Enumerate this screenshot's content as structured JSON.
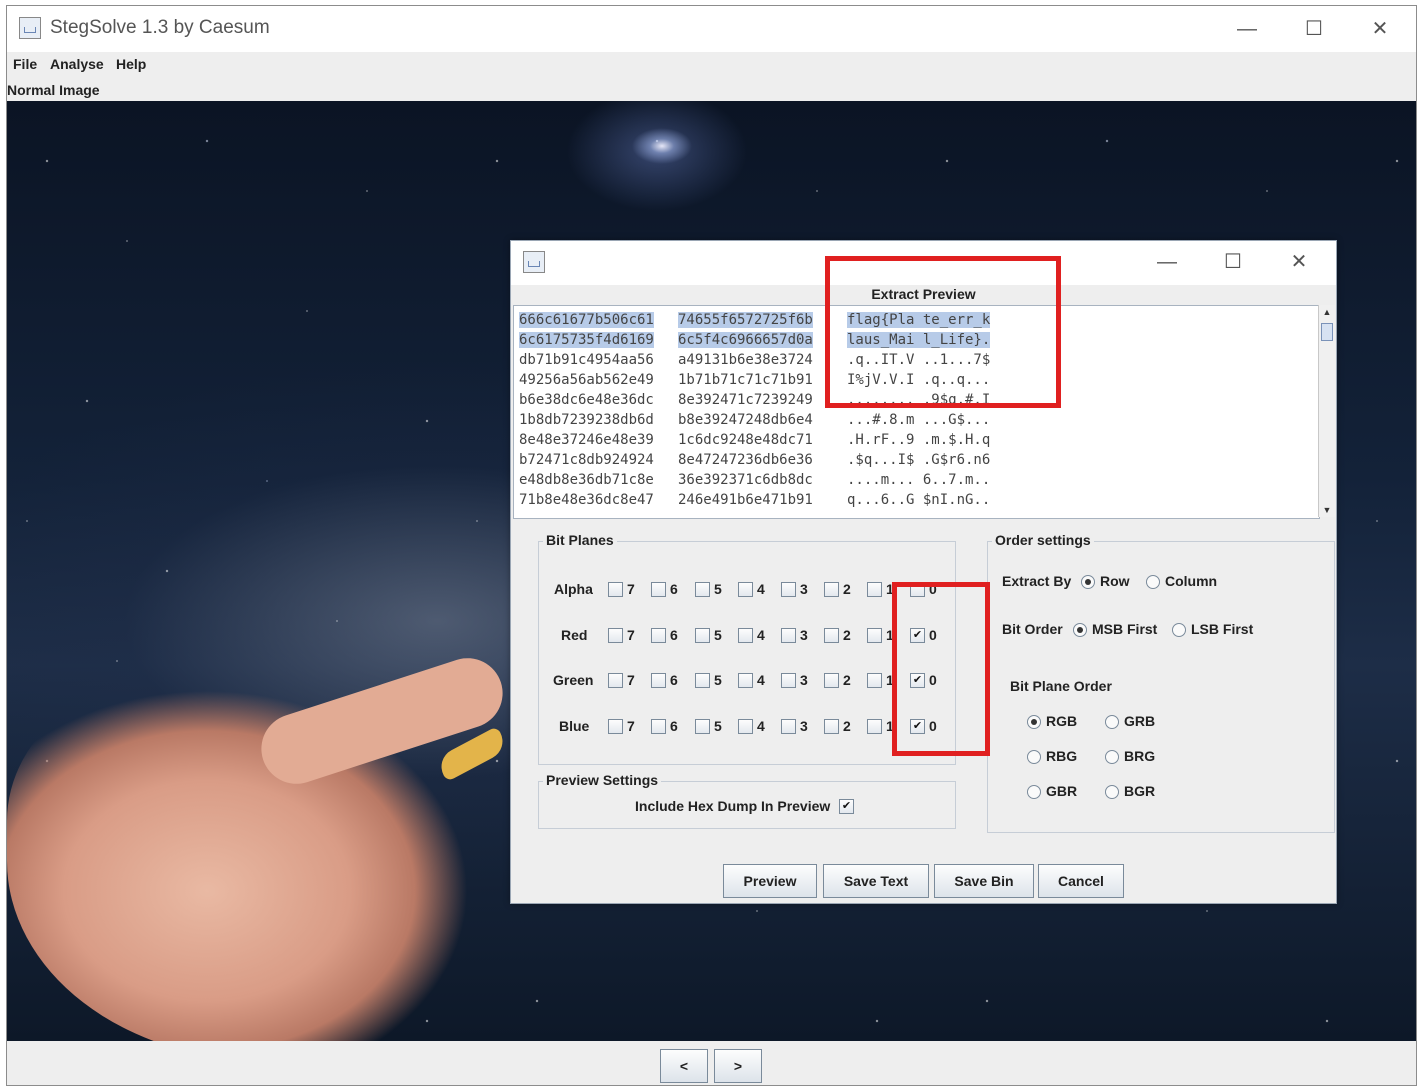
{
  "window": {
    "title": "StegSolve 1.3 by Caesum",
    "controls": {
      "minimize": "—",
      "maximize": "☐",
      "close": "✕"
    }
  },
  "menu": [
    "File",
    "Analyse",
    "Help"
  ],
  "image_label": "Normal Image",
  "nav": {
    "prev": "<",
    "next": ">"
  },
  "dialog": {
    "controls": {
      "minimize": "—",
      "maximize": "☐",
      "close": "✕"
    },
    "extract_preview_label": "Extract Preview",
    "hex_lines": [
      {
        "h1": "666c61677b506c61",
        "h2": "74655f6572725f6b",
        "ascii": "flag{Pla te_err_k",
        "selected": true
      },
      {
        "h1": "6c6175735f4d6169",
        "h2": "6c5f4c6966657d0a",
        "ascii": "laus_Mai l_Life}.",
        "selected": true
      },
      {
        "h1": "db71b91c4954aa56",
        "h2": "a49131b6e38e3724",
        "ascii": ".q..IT.V ..1...7$"
      },
      {
        "h1": "49256a56ab562e49",
        "h2": "1b71b71c71c71b91",
        "ascii": "I%jV.V.I .q..q..."
      },
      {
        "h1": "b6e38dc6e48e36dc",
        "h2": "8e392471c7239249",
        "ascii": "........ .9$q.#.I"
      },
      {
        "h1": "1b8db7239238db6d",
        "h2": "b8e39247248db6e4",
        "ascii": "...#.8.m ...G$..."
      },
      {
        "h1": "8e48e37246e48e39",
        "h2": "1c6dc9248e48dc71",
        "ascii": ".H.rF..9 .m.$.H.q"
      },
      {
        "h1": "b72471c8db924924",
        "h2": "8e47247236db6e36",
        "ascii": ".$q...I$ .G$r6.n6"
      },
      {
        "h1": "e48db8e36db71c8e",
        "h2": "36e392371c6db8dc",
        "ascii": "....m... 6..7.m.."
      },
      {
        "h1": "71b8e48e36dc8e47",
        "h2": "246e491b6e471b91",
        "ascii": "q...6..G $nI.nG.."
      }
    ],
    "bit_planes": {
      "title": "Bit Planes",
      "rows": [
        {
          "name": "Alpha",
          "checked": []
        },
        {
          "name": "Red",
          "checked": [
            "0"
          ]
        },
        {
          "name": "Green",
          "checked": [
            "0"
          ]
        },
        {
          "name": "Blue",
          "checked": [
            "0"
          ]
        }
      ],
      "bits": [
        "7",
        "6",
        "5",
        "4",
        "3",
        "2",
        "1",
        "0"
      ]
    },
    "preview_settings": {
      "title": "Preview Settings",
      "include_hex_label": "Include Hex Dump In Preview",
      "include_hex_checked": true
    },
    "order_settings": {
      "title": "Order settings",
      "extract_by_label": "Extract By",
      "extract_by_options": [
        "Row",
        "Column"
      ],
      "extract_by_selected": "Row",
      "bit_order_label": "Bit Order",
      "bit_order_options": [
        "MSB First",
        "LSB First"
      ],
      "bit_order_selected": "MSB First",
      "bit_plane_order_label": "Bit Plane Order",
      "bit_plane_order_options": [
        "RGB",
        "GRB",
        "RBG",
        "BRG",
        "GBR",
        "BGR"
      ],
      "bit_plane_order_selected": "RGB"
    },
    "buttons": [
      "Preview",
      "Save Text",
      "Save Bin",
      "Cancel"
    ]
  },
  "colors": {
    "highlight": "#e02020",
    "selection": "#b7cbe8"
  }
}
